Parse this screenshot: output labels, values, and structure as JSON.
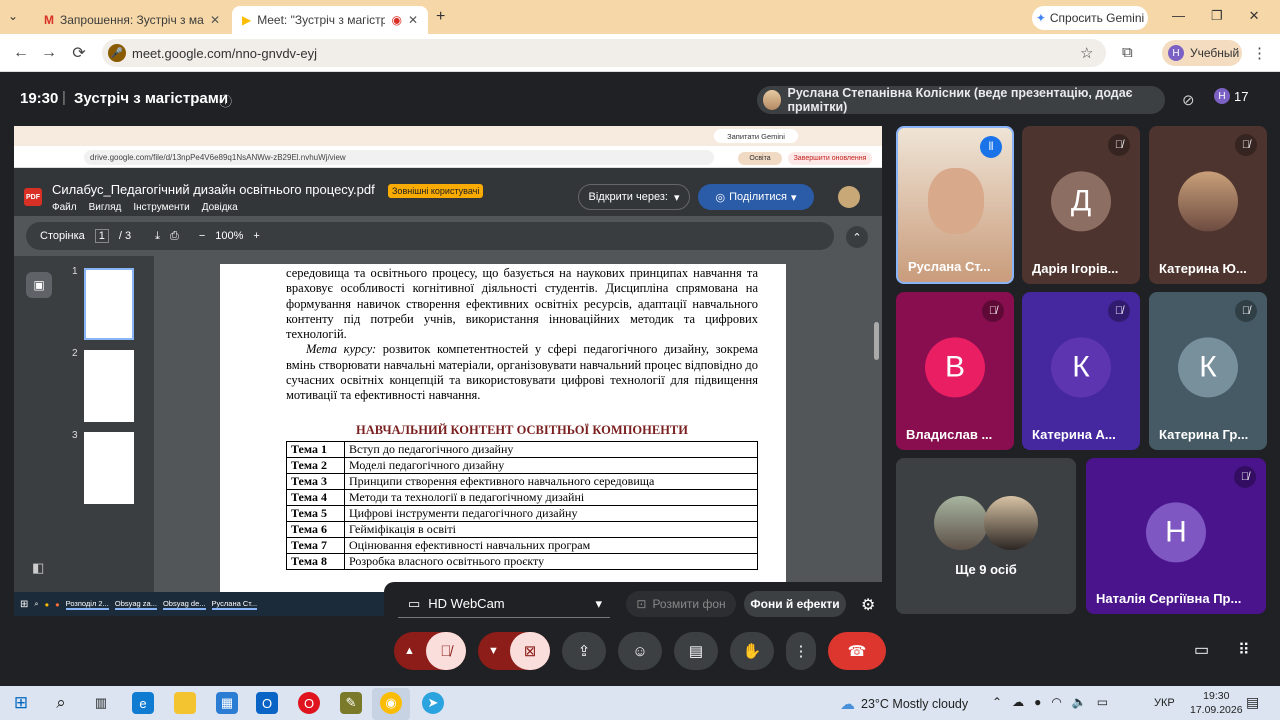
{
  "browser": {
    "tabs": [
      {
        "label": "Запрошення: Зустріч з магістр",
        "icon": "gmail-icon"
      },
      {
        "label": "Meet: \"Зустріч з магістрам",
        "icon": "meet-icon"
      }
    ],
    "new_tab": "+",
    "gemini_label": "Спросить Gemini",
    "url": "meet.google.com/nno-gnvdv-eyj",
    "profile_initial": "Н",
    "profile_label": "Учебный",
    "accent": "#f6d8a8"
  },
  "meet": {
    "time": "19:30",
    "separator": "|",
    "title": "Зустріч з магістрами",
    "presenter": "Руслана Степанівна Колісник (веде презентацію, додає примітки)",
    "participants_count": "17",
    "participants_initial": "Н"
  },
  "shared": {
    "inner_url": "drive.google.com/file/d/13npPe4V6e89q1NsANWw-zB29El.nvhuWj/view",
    "inner_gemini": "Запитати Gemini",
    "inner_profile": "Освіта",
    "inner_update": "Завершити оновлення",
    "pdf_badge": "PDF",
    "pdf_title": "Силабус_Педагогічний дизайн освітнього процесу.pdf",
    "external_badge": "Зовнішні користувачі",
    "menu": [
      "Файл",
      "Вигляд",
      "Інструменти",
      "Довідка"
    ],
    "open_with": "Відкрити через:",
    "share": "Поділитися",
    "page_label": "Сторінка",
    "page_current": "1",
    "page_total": "/ 3",
    "zoom": "100%",
    "thumbs": [
      "1",
      "2",
      "3"
    ],
    "para1": "середовища та освітнього процесу, що базується на наукових принципах навчання та враховує особливості когнітивної діяльності студентів. Дисципліна спрямована на формування навичок створення ефективних освітніх ресурсів, адаптації навчального контенту під потреби учнів, використання інноваційних методик та цифрових технологій.",
    "goal_label": "Мета курсу:",
    "goal_text": " розвиток компетентностей у сфері педагогічного дизайну, зокрема вмінь створювати навчальні матеріали, організовувати навчальний процес відповідно до сучасних освітніх концепцій та використовувати цифрові технології для підвищення мотивації та ефективності навчання.",
    "content_title": "НАВЧАЛЬНИЙ КОНТЕНТ ОСВІТНЬОЇ КОМПОНЕНТИ",
    "topics": [
      {
        "num": "Тема 1",
        "name": "Вступ до педагогічного дизайну"
      },
      {
        "num": "Тема 2",
        "name": "Моделі педагогічного дизайну"
      },
      {
        "num": "Тема 3",
        "name": "Принципи створення ефективного навчального середовища"
      },
      {
        "num": "Тема 4",
        "name": "Методи та технології в педагогічному дизайні"
      },
      {
        "num": "Тема 5",
        "name": "Цифрові інструменти педагогічного дизайну"
      },
      {
        "num": "Тема 6",
        "name": "Гейміфікація в освіті"
      },
      {
        "num": "Тема 7",
        "name": "Оцінювання ефективності навчальних програм"
      },
      {
        "num": "Тема 8",
        "name": "Розробка власного освітнього проєкту"
      }
    ],
    "taskbar_items": [
      "Розподіл 2...",
      "Obsyag za...",
      "Obsyag de...",
      "Руслана Ст..."
    ]
  },
  "participants": [
    {
      "name": "Руслана Ст...",
      "initial": "",
      "color": "#e9d7c3"
    },
    {
      "name": "Дарія Ігорів...",
      "initial": "Д",
      "color": "#8d6e63"
    },
    {
      "name": "Катерина Ю...",
      "initial": "",
      "color": "#5d4037"
    },
    {
      "name": "Владислав ...",
      "initial": "В",
      "color": "#e91e63"
    },
    {
      "name": "Катерина А...",
      "initial": "К",
      "color": "#5e35b1"
    },
    {
      "name": "Катерина Гр...",
      "initial": "К",
      "color": "#78909c"
    },
    {
      "name": "Наталія Сергіївна Пр...",
      "initial": "Н",
      "color": "#7e57c2"
    }
  ],
  "others_label": "Ще 9 осіб",
  "controls": {
    "camera": "HD WebCam",
    "blur": "Розмити фон",
    "effects": "Фони й ефекти"
  },
  "windows": {
    "weather": "23°C  Mostly cloudy",
    "lang": "УКР",
    "time": "19:30",
    "date": "17.09.2026"
  }
}
